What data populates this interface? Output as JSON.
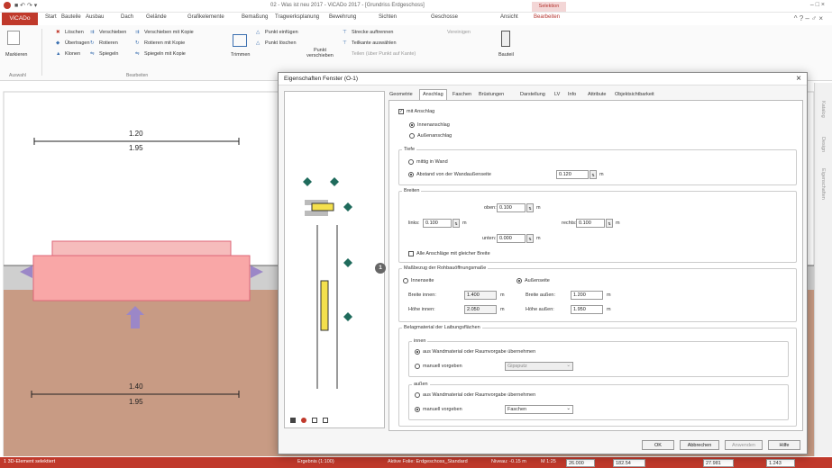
{
  "window": {
    "title": "02 - Was ist neu 2017 - ViCADo 2017 - [Grundriss Erdgeschoss]",
    "context_tab": "Selektion",
    "controls": "– □ ×",
    "help": "^ ? – ♂ ×"
  },
  "ribbon_tabs": [
    "ViCADo",
    "Start",
    "Bauteile",
    "Ausbau",
    "Dach",
    "Gelände",
    "Grafikelemente",
    "Bemaßung",
    "Tragwerksplanung",
    "Bewehrung",
    "Sichten",
    "Geschosse",
    "Ansicht",
    "Bearbeiten"
  ],
  "ribbon": {
    "auswahl": {
      "group": "Auswahl",
      "markieren": "Markieren"
    },
    "bearbeiten": {
      "group": "Bearbeiten",
      "loeschen": "Löschen",
      "verschieben": "Verschieben",
      "verschieben_kopie": "Verschieben mit Kopie",
      "uebertragen": "Übertragen",
      "rotieren": "Rotieren",
      "rotieren_kopie": "Rotieren mit Kopie",
      "klonen": "Klonen",
      "spiegeln": "Spiegeln",
      "spiegeln_kopie": "Spiegeln mit Kopie"
    },
    "trimmen": "Trimmen",
    "punkt_einfuegen": "Punkt einfügen",
    "punkt_loeschen": "Punkt löschen",
    "punkt_verschieben": "Punkt verschieben",
    "strecke": "Strecke auftrennen",
    "teilkante": "Teilkante auswählen",
    "teilen": "Teilen (über Punkt auf Kante)",
    "vereinigen": "Vereinigen",
    "bauteil": "Bauteil"
  },
  "drawing": {
    "dim_top_1": "1.20",
    "dim_top_2": "1.95",
    "dim_bot_1": "1.40",
    "dim_bot_2": "1.95"
  },
  "side_panel": [
    "Katalog",
    "Design",
    "Eigenschaften"
  ],
  "dialog": {
    "title": "Eigenschaften Fenster (O-1)",
    "tabs": [
      "Geometrie",
      "Anschlag",
      "Faschen",
      "Brüstungen",
      "Darstellung",
      "LV",
      "Info",
      "Attribute",
      "Objektsichtbarkeit"
    ],
    "mit_anschlag": "mit Anschlag",
    "innenanschlag": "Innenanschlag",
    "aussenanschlag": "Außenanschlag",
    "tiefe": {
      "label": "Tiefe",
      "mittig": "mittig in Wand",
      "abstand": "Abstand von der Wandaußenseite",
      "value": "0.120",
      "unit": "m"
    },
    "breiten": {
      "label": "Breiten",
      "oben_label": "oben:",
      "oben": "0.100",
      "links_label": "links:",
      "links": "0.100",
      "rechts_label": "rechts:",
      "rechts": "0.100",
      "unten_label": "unten:",
      "unten": "0.000",
      "unit": "m",
      "alle": "Alle Anschläge mit gleicher Breite"
    },
    "massbezug": {
      "label": "Maßbezug der Rohbauöffnungsmaße",
      "innenseite": "Innenseite",
      "aussenseite": "Außenseite",
      "breite_innen_label": "Breite innen:",
      "breite_innen": "1.400",
      "hoehe_innen_label": "Höhe innen:",
      "hoehe_innen": "2.050",
      "breite_aussen_label": "Breite außen:",
      "breite_aussen": "1.200",
      "hoehe_aussen_label": "Höhe außen:",
      "hoehe_aussen": "1.950",
      "unit": "m"
    },
    "belag": {
      "label": "Belagmaterial der Laibungsflächen",
      "innen": "innen",
      "aussen": "außen",
      "aus_wand": "aus Wandmaterial oder Raumvorgabe übernehmen",
      "manuell": "manuell vorgeben",
      "innen_value": "Gipsputz",
      "aussen_value": "Faschen"
    },
    "buttons": {
      "ok": "OK",
      "abbrechen": "Abbrechen",
      "anwenden": "Anwenden",
      "hilfe": "Hilfe"
    },
    "badge": "1"
  },
  "status": {
    "left": "1 3D-Element selektiert",
    "view": "Ergebnis (1:100)",
    "folie": "Aktive Folie: Erdgeschoss_Standard",
    "niveau": "Niveau: -0.15 m",
    "massstab": "M 1:25",
    "v1": "26.000",
    "v2": "182.54",
    "v3": "27.981",
    "v4": "1.243"
  },
  "colors": {
    "accent": "#c0392b",
    "window_fill": "#f9a7a7",
    "ground": "#c89b84",
    "wall": "#cfcfcf",
    "arrow": "#9b87c7"
  }
}
